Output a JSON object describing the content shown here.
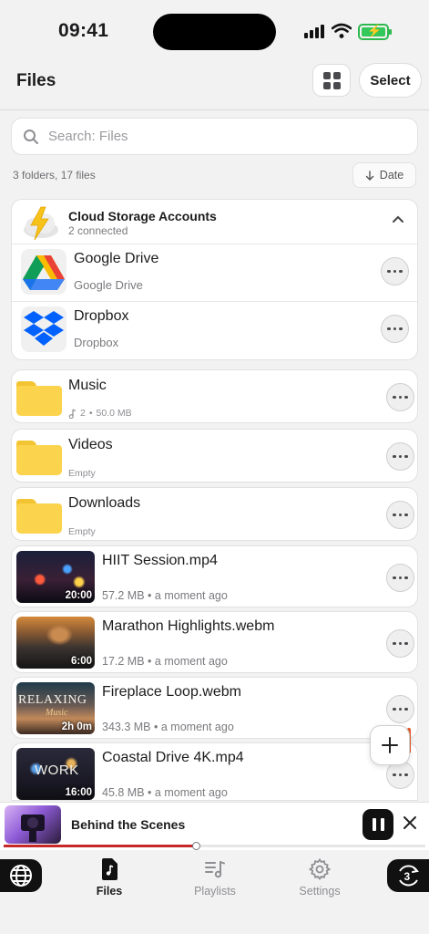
{
  "status": {
    "time": "09:41"
  },
  "header": {
    "title": "Files",
    "select_label": "Select"
  },
  "search": {
    "placeholder": "Search: Files"
  },
  "summary": {
    "counts": "3 folders, 17 files",
    "sort_label": "Date"
  },
  "cloud": {
    "title": "Cloud Storage Accounts",
    "subtitle": "2 connected",
    "providers": [
      {
        "name": "Google Drive",
        "sub": "Google Drive"
      },
      {
        "name": "Dropbox",
        "sub": "Dropbox"
      }
    ]
  },
  "folders": [
    {
      "name": "Music",
      "count": "2",
      "size": "50.0 MB"
    },
    {
      "name": "Videos",
      "meta": "Empty"
    },
    {
      "name": "Downloads",
      "meta": "Empty"
    }
  ],
  "videos": [
    {
      "name": "HIIT Session.mp4",
      "duration": "20:00",
      "size": "57.2 MB",
      "time": "a moment ago"
    },
    {
      "name": "Marathon Highlights.webm",
      "duration": "6:00",
      "size": "17.2 MB",
      "time": "a moment ago"
    },
    {
      "name": "Fireplace Loop.webm",
      "duration": "2h 0m",
      "size": "343.3 MB",
      "time": "a moment ago",
      "thumb_text": "RELAXING",
      "thumb_sub": "Music"
    },
    {
      "name": "Coastal Drive 4K.mp4",
      "duration": "16:00",
      "size": "45.8 MB",
      "time": "a moment ago",
      "thumb_text": "WORK"
    }
  ],
  "player": {
    "title": "Behind the Scenes",
    "progress": 0.455
  },
  "tabs": [
    {
      "label": "Files",
      "icon": "music-file-icon",
      "active": true
    },
    {
      "label": "Playlists",
      "icon": "playlist-icon"
    },
    {
      "label": "Settings",
      "icon": "gear-icon"
    }
  ],
  "icons": [
    "globe-icon",
    "speed-3-icon",
    "cloud-lightning-icon",
    "google-drive-icon",
    "dropbox-icon",
    "search-icon",
    "grid-icon",
    "chevron-up-icon",
    "arrow-down-icon",
    "plus-icon",
    "pause-icon",
    "close-icon",
    "note-icon"
  ],
  "colors": {
    "accent": "#c62828",
    "folder": "#fcd34d",
    "battery": "#34c759"
  }
}
